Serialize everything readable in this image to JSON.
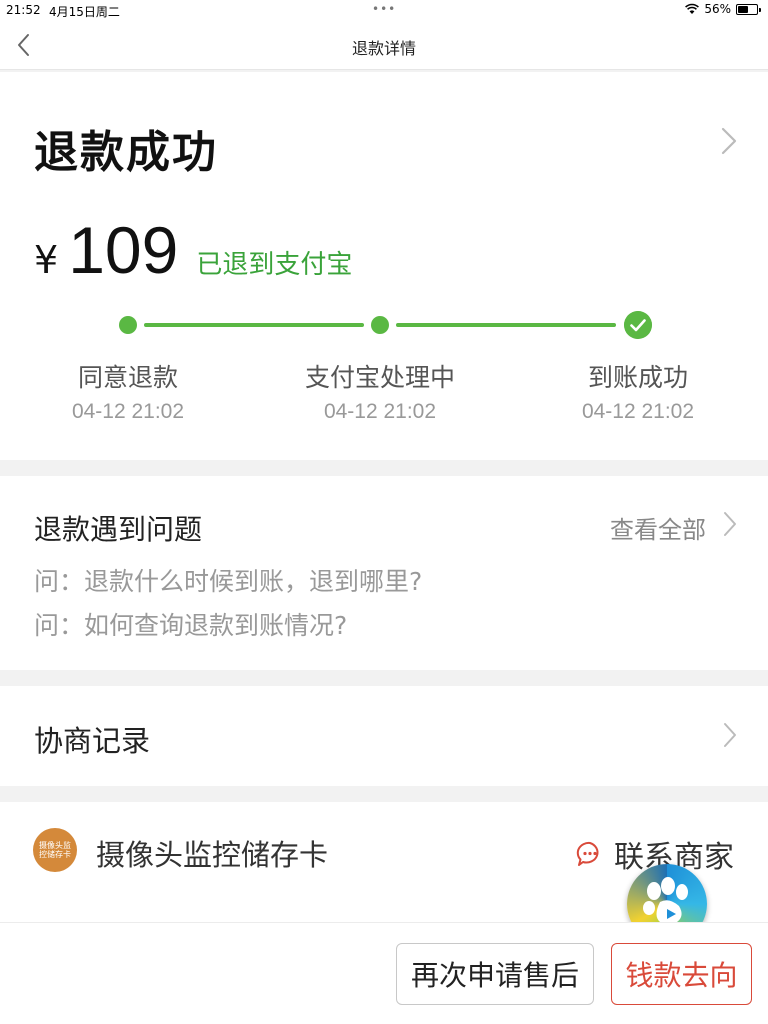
{
  "status_bar": {
    "time": "21:52",
    "date": "4月15日周二",
    "dots": "•••",
    "battery": "56%",
    "battery_level": 0.56
  },
  "nav": {
    "title": "退款详情"
  },
  "refund": {
    "status": "退款成功",
    "currency": "¥",
    "amount": "109",
    "destination": "已退到支付宝"
  },
  "timeline": {
    "steps": [
      {
        "label": "同意退款",
        "time": "04-12 21:02"
      },
      {
        "label": "支付宝处理中",
        "time": "04-12 21:02"
      },
      {
        "label": "到账成功",
        "time": "04-12 21:02"
      }
    ]
  },
  "faq": {
    "title": "退款遇到问题",
    "more_label": "查看全部",
    "questions": [
      "问：退款什么时候到账，退到哪里?",
      "问：如何查询退款到账情况?"
    ]
  },
  "negotiation": {
    "title": "协商记录"
  },
  "shop": {
    "logo_text": "摄像头监控储存卡",
    "name": "摄像头监控储存卡",
    "contact_label": "联系商家"
  },
  "actions": {
    "apply_again": "再次申请售后",
    "money_trace": "钱款去向"
  },
  "colors": {
    "accent_green": "#5ab843",
    "refund_text_green": "#3aa33a",
    "danger_red": "#d94a3a",
    "shop_logo": "#d4893a"
  },
  "icons": [
    "back-arrow-icon",
    "chevron-right-icon",
    "check-icon",
    "wifi-icon",
    "battery-icon",
    "chat-bubble-icon",
    "paw-float-icon"
  ]
}
